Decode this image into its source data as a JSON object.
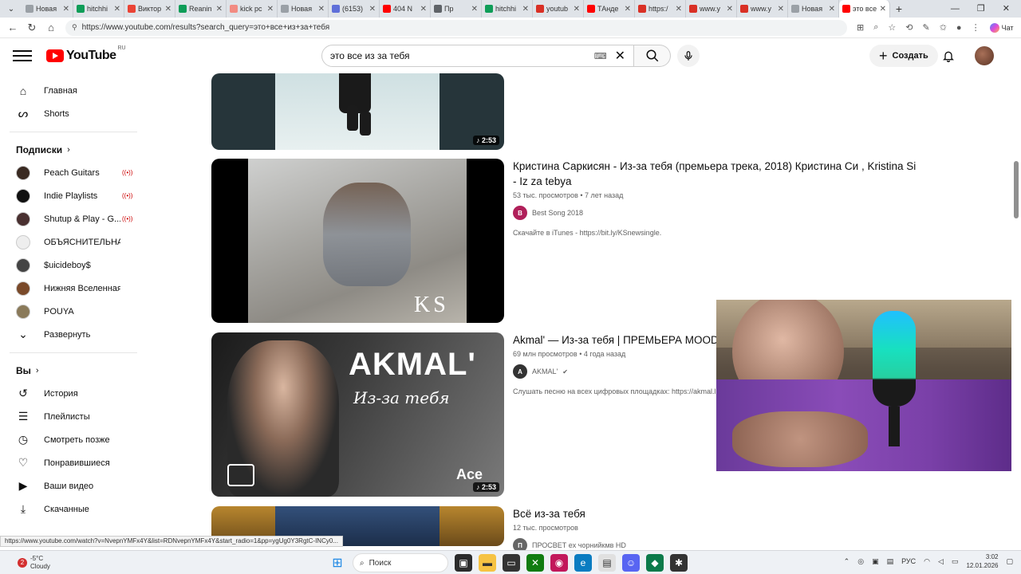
{
  "browser": {
    "tabs": [
      {
        "title": "Новая",
        "color": "#9aa0a6"
      },
      {
        "title": "hitchhi",
        "color": "#0f9d58"
      },
      {
        "title": "Виктор",
        "color": "#ea4335"
      },
      {
        "title": "Reanin",
        "color": "#0f9d58"
      },
      {
        "title": "kick pc",
        "color": "#f28b82"
      },
      {
        "title": "Новая",
        "color": "#9aa0a6"
      },
      {
        "title": "(6153)",
        "color": "#5f6fd9"
      },
      {
        "title": "404 N",
        "color": "#ff0000"
      },
      {
        "title": "Пр",
        "color": "#5f6368"
      },
      {
        "title": "hitchhi",
        "color": "#0f9d58"
      },
      {
        "title": "youtub",
        "color": "#d93025"
      },
      {
        "title": "ТАнде",
        "color": "#ff0000"
      },
      {
        "title": "https:/",
        "color": "#d93025"
      },
      {
        "title": "www.y",
        "color": "#d93025"
      },
      {
        "title": "www.y",
        "color": "#d93025"
      },
      {
        "title": "Новая",
        "color": "#9aa0a6"
      },
      {
        "title": "это все",
        "color": "#ff0000",
        "active": true
      }
    ],
    "url": "https://www.youtube.com/results?search_query=это+все+из+за+тебя",
    "ai_chat_label": "Чат"
  },
  "youtube": {
    "logo_text": "YouTube",
    "region": "RU",
    "search_value": "это все из за тебя",
    "create_label": "Создать"
  },
  "sidebar": {
    "main": [
      {
        "label": "Главная",
        "icon": "home-icon",
        "glyph": "⌂"
      },
      {
        "label": "Shorts",
        "icon": "shorts-icon",
        "glyph": "ᔕ"
      }
    ],
    "subs_heading": "Подписки",
    "subs": [
      {
        "label": "Peach Guitars",
        "live": true,
        "color": "#3a2a22"
      },
      {
        "label": "Indie Playlists",
        "live": true,
        "color": "#111111"
      },
      {
        "label": "Shutup & Play - G...",
        "live": true,
        "color": "#4a3030"
      },
      {
        "label": "ОБЪЯСНИТЕЛЬНАЯ",
        "live": false,
        "color": "#eeeeee"
      },
      {
        "label": "$uicideboy$",
        "live": false,
        "color": "#444444"
      },
      {
        "label": "Нижняя Вселенная",
        "live": false,
        "color": "#7a4a2a"
      },
      {
        "label": "POUYA",
        "live": false,
        "color": "#8a7a5a"
      }
    ],
    "expand_label": "Развернуть",
    "you_heading": "Вы",
    "you": [
      {
        "label": "История",
        "icon": "history-icon",
        "glyph": "↺"
      },
      {
        "label": "Плейлисты",
        "icon": "playlists-icon",
        "glyph": "☰"
      },
      {
        "label": "Смотреть позже",
        "icon": "watch-later-icon",
        "glyph": "◷"
      },
      {
        "label": "Понравившиеся",
        "icon": "like-icon",
        "glyph": "♡"
      },
      {
        "label": "Ваши видео",
        "icon": "your-videos-icon",
        "glyph": "▶"
      },
      {
        "label": "Скачанные",
        "icon": "downloads-icon",
        "glyph": "⤓"
      }
    ]
  },
  "results": [
    {
      "duration": "2:53"
    },
    {
      "title": "Кристина Саркисян - Из-за тебя (премьера трека, 2018) Кристина Си , Kristina Si - Iz za tebya",
      "meta": "53 тыс. просмотров • 7 лет назад",
      "channel": "Best Song 2018",
      "channel_initial": "B",
      "channel_color": "#b0205a",
      "description": "Скачайте в iTunes - https://bit.ly/KSnewsingle.",
      "thumb_text": "KS"
    },
    {
      "title": "Akmal' — Из-за тебя | ПРЕМЬЕРА MOOD VI",
      "meta": "69 млн просмотров • 4 года назад",
      "channel": "AKMAL'",
      "channel_initial": "A",
      "channel_color": "#333333",
      "description": "Слушать песню на всех цифровых площадках: https://akmal.lr",
      "duration": "2:53",
      "thumb_title": "AKMAL'",
      "thumb_subtitle": "Из-за тебя",
      "thumb_badge": "Ace"
    },
    {
      "title": "Всё из-за тебя",
      "meta": "12 тыс. просмотров",
      "channel": "ПРОСВЕТ ex чорнийкмв HD",
      "channel_initial": "П",
      "channel_color": "#666666"
    }
  ],
  "status_url": "https://www.youtube.com/watch?v=NvepnYMFx4Y&list=RDNvepnYMFx4Y&start_radio=1&pp=ygUg0Y3RgtC-INCy0...",
  "taskbar": {
    "weather_badge": "2",
    "temperature": "-5°C",
    "condition": "Cloudy",
    "search_label": "Поиск",
    "lang": "РУС",
    "time": "3:02",
    "date": "12.01.2026"
  }
}
